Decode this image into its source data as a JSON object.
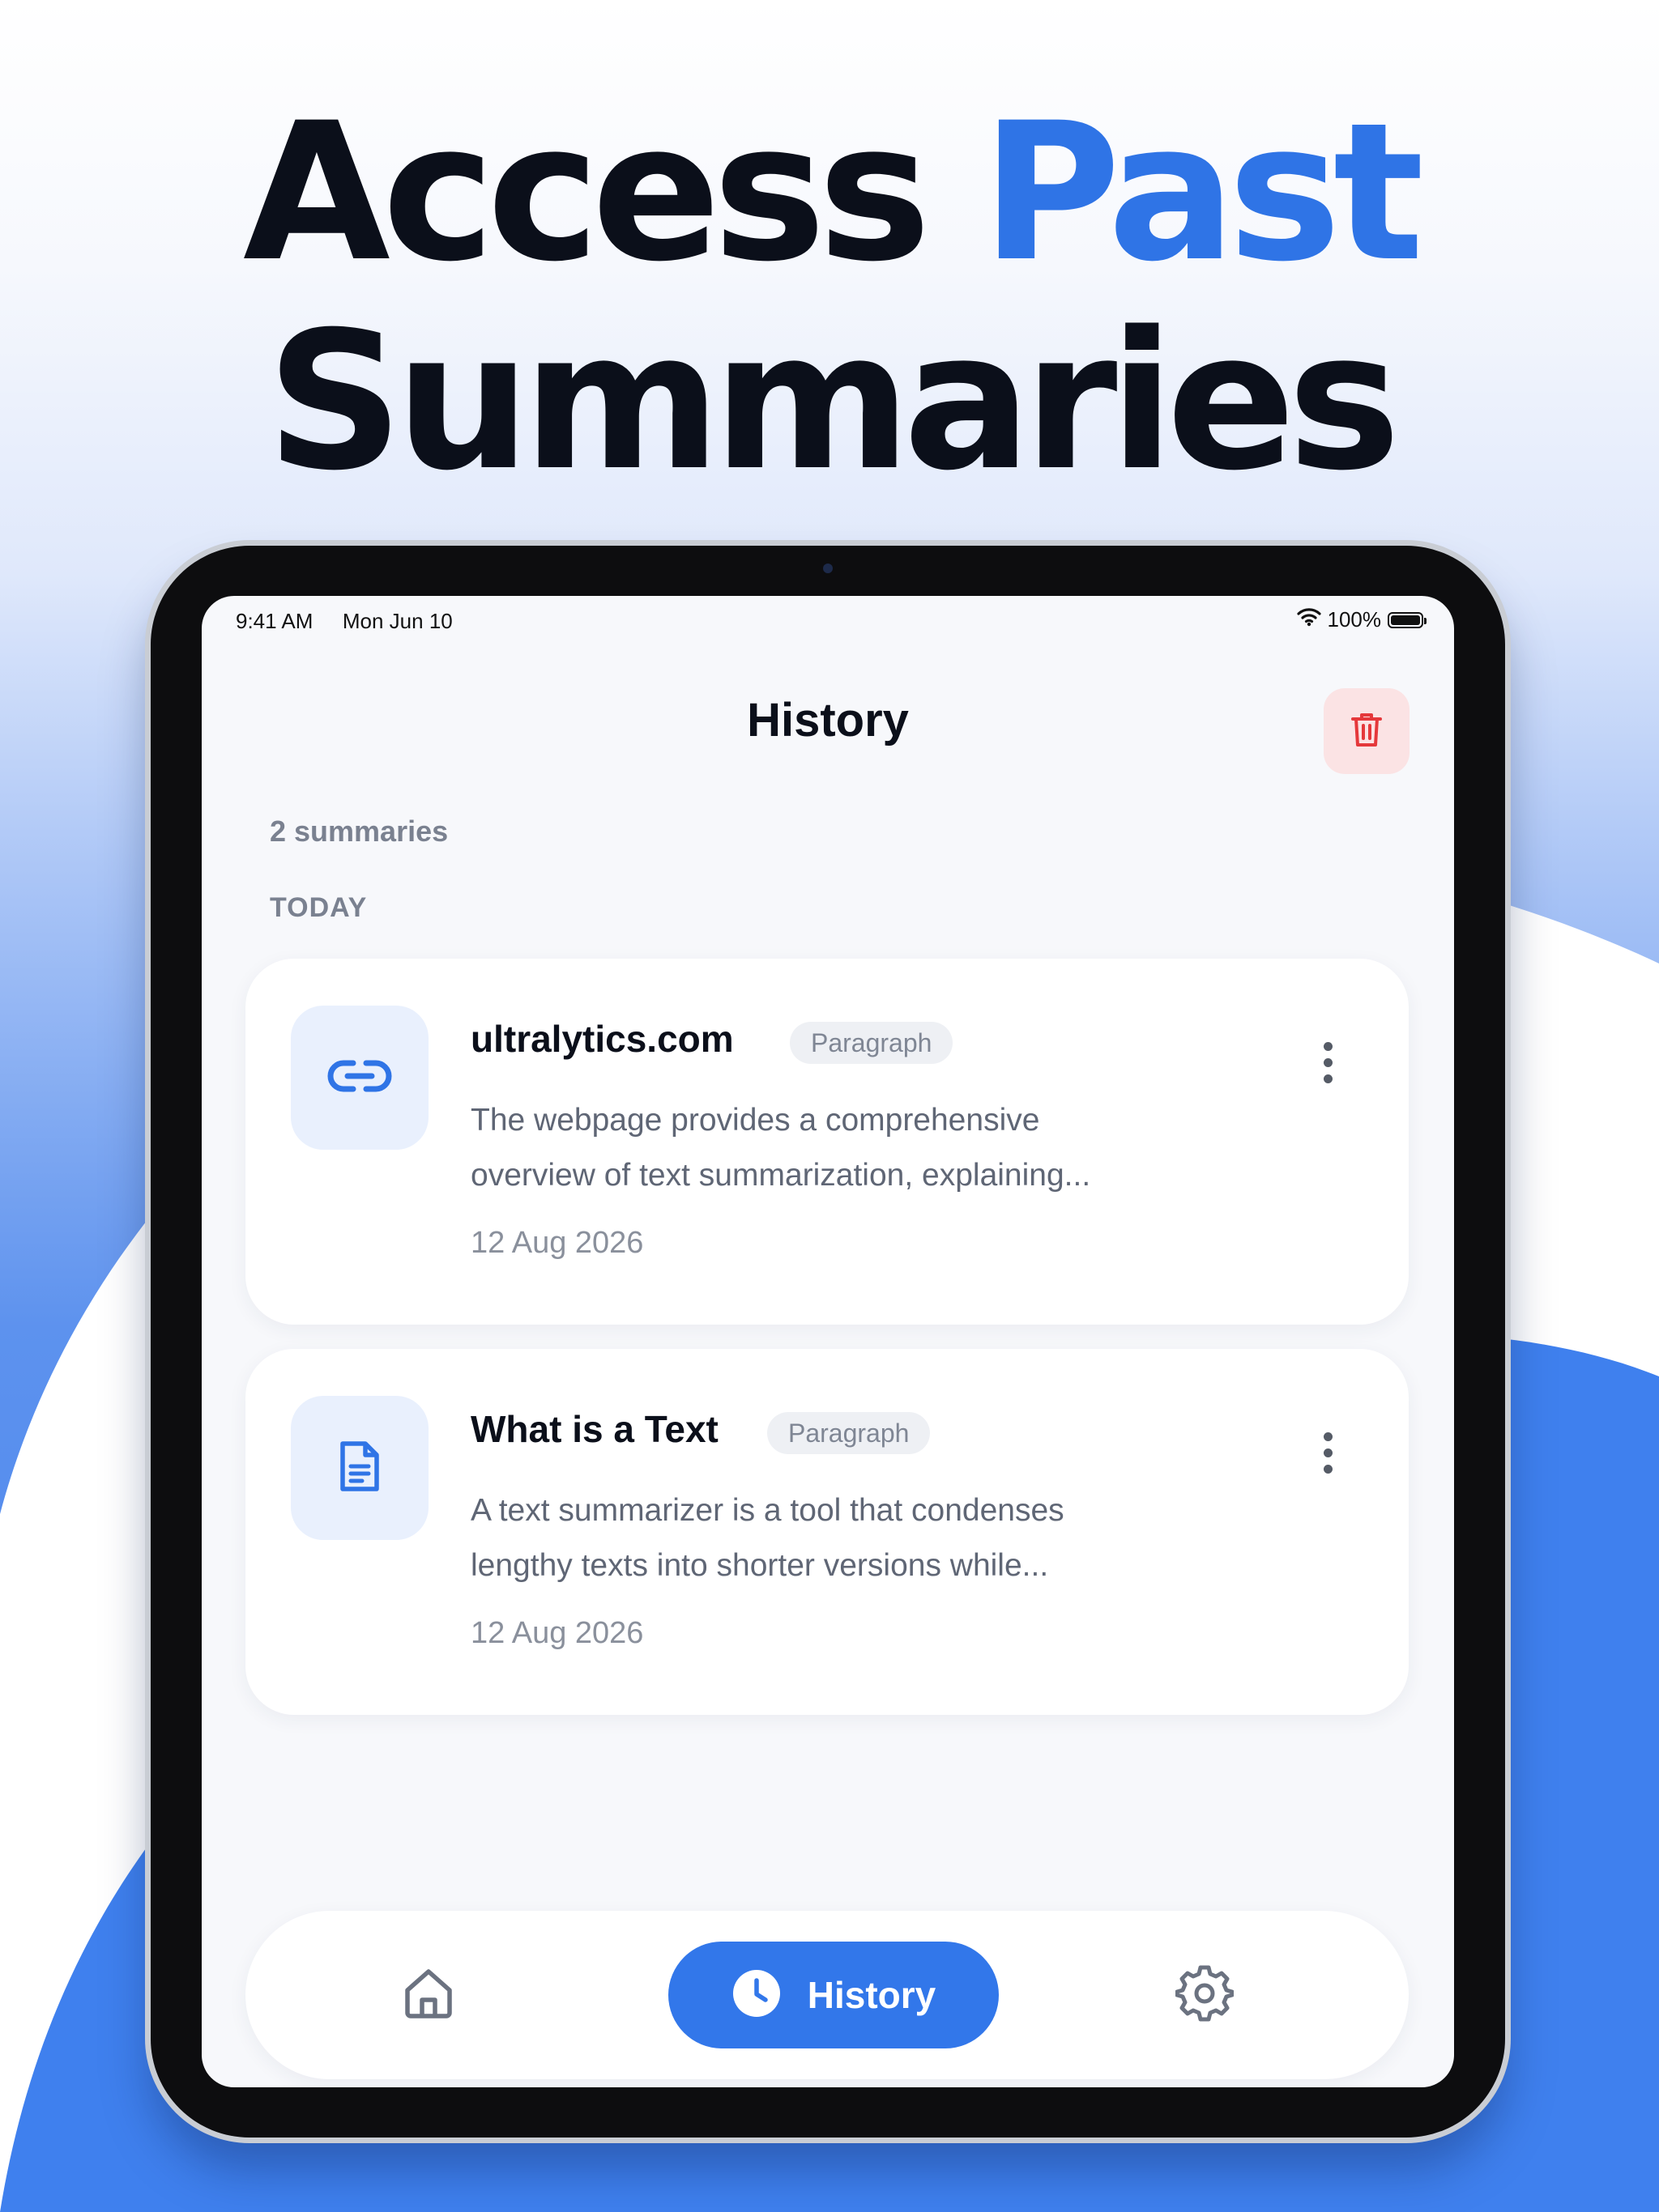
{
  "headline": {
    "line1_dark": "Access",
    "line1_accent": "Past",
    "line2": "Summaries"
  },
  "status_bar": {
    "time": "9:41 AM",
    "date": "Mon Jun 10",
    "battery": "100%",
    "battery_level": 1.0
  },
  "header": {
    "title": "History",
    "trash_icon": "trash-icon"
  },
  "summary_count": "2 summaries",
  "section_label": "TODAY",
  "items": [
    {
      "icon": "link-icon",
      "title": "ultralytics.com",
      "badge": "Paragraph",
      "description": "The webpage provides a comprehensive overview of text summarization, explaining...",
      "date": "12 Aug 2026"
    },
    {
      "icon": "document-icon",
      "title": "What is a Text",
      "badge": "Paragraph",
      "description": "A text summarizer is a tool that condenses lengthy texts into shorter versions while...",
      "date": "12 Aug 2026"
    }
  ],
  "bottom_nav": {
    "home_icon": "home-icon",
    "history_label": "History",
    "history_icon": "clock-icon",
    "settings_icon": "gear-icon",
    "active": "History"
  },
  "colors": {
    "accent": "#2f74e6",
    "nav_active": "#3277ea",
    "danger": "#e5383b",
    "danger_bg": "#fbe3e4",
    "icon_bg": "#e9f0fd"
  }
}
